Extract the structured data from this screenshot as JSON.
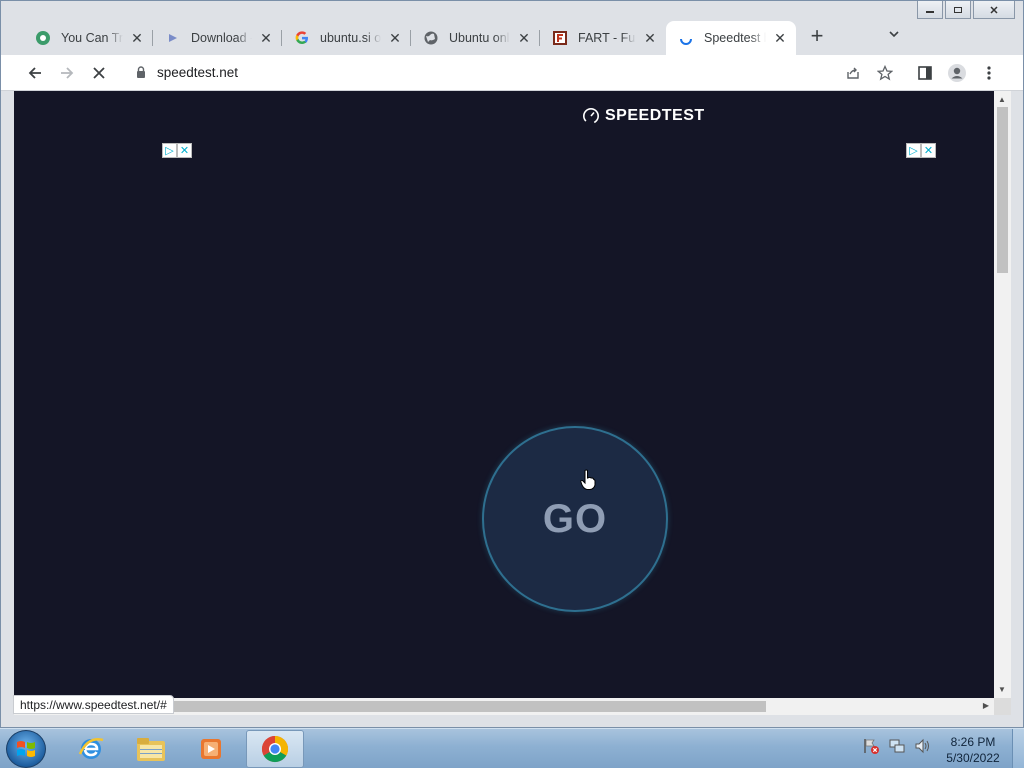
{
  "browser": {
    "tabs": [
      {
        "title": "You Can Try",
        "icon": "green-gear-icon",
        "active": false
      },
      {
        "title": "Download -",
        "icon": "arrow-icon",
        "active": false
      },
      {
        "title": "ubuntu.si or",
        "icon": "google-icon",
        "active": false
      },
      {
        "title": "Ubuntu onli",
        "icon": "globe-icon",
        "active": false
      },
      {
        "title": "FART - Funn",
        "icon": "fart-icon",
        "active": false
      },
      {
        "title": "Speedtest b",
        "icon": "loading-spinner-icon",
        "active": true
      }
    ],
    "address_bar": {
      "url": "speedtest.net"
    },
    "status_text": "https://www.speedtest.net/#"
  },
  "page": {
    "logo_text": "SPEEDTEST",
    "go_label": "GO"
  },
  "taskbar": {
    "time": "8:26 PM",
    "date": "5/30/2022"
  },
  "colors": {
    "page_bg": "#141526",
    "go_ring": "#2e6f8f",
    "go_fill": "#1c2a44"
  }
}
